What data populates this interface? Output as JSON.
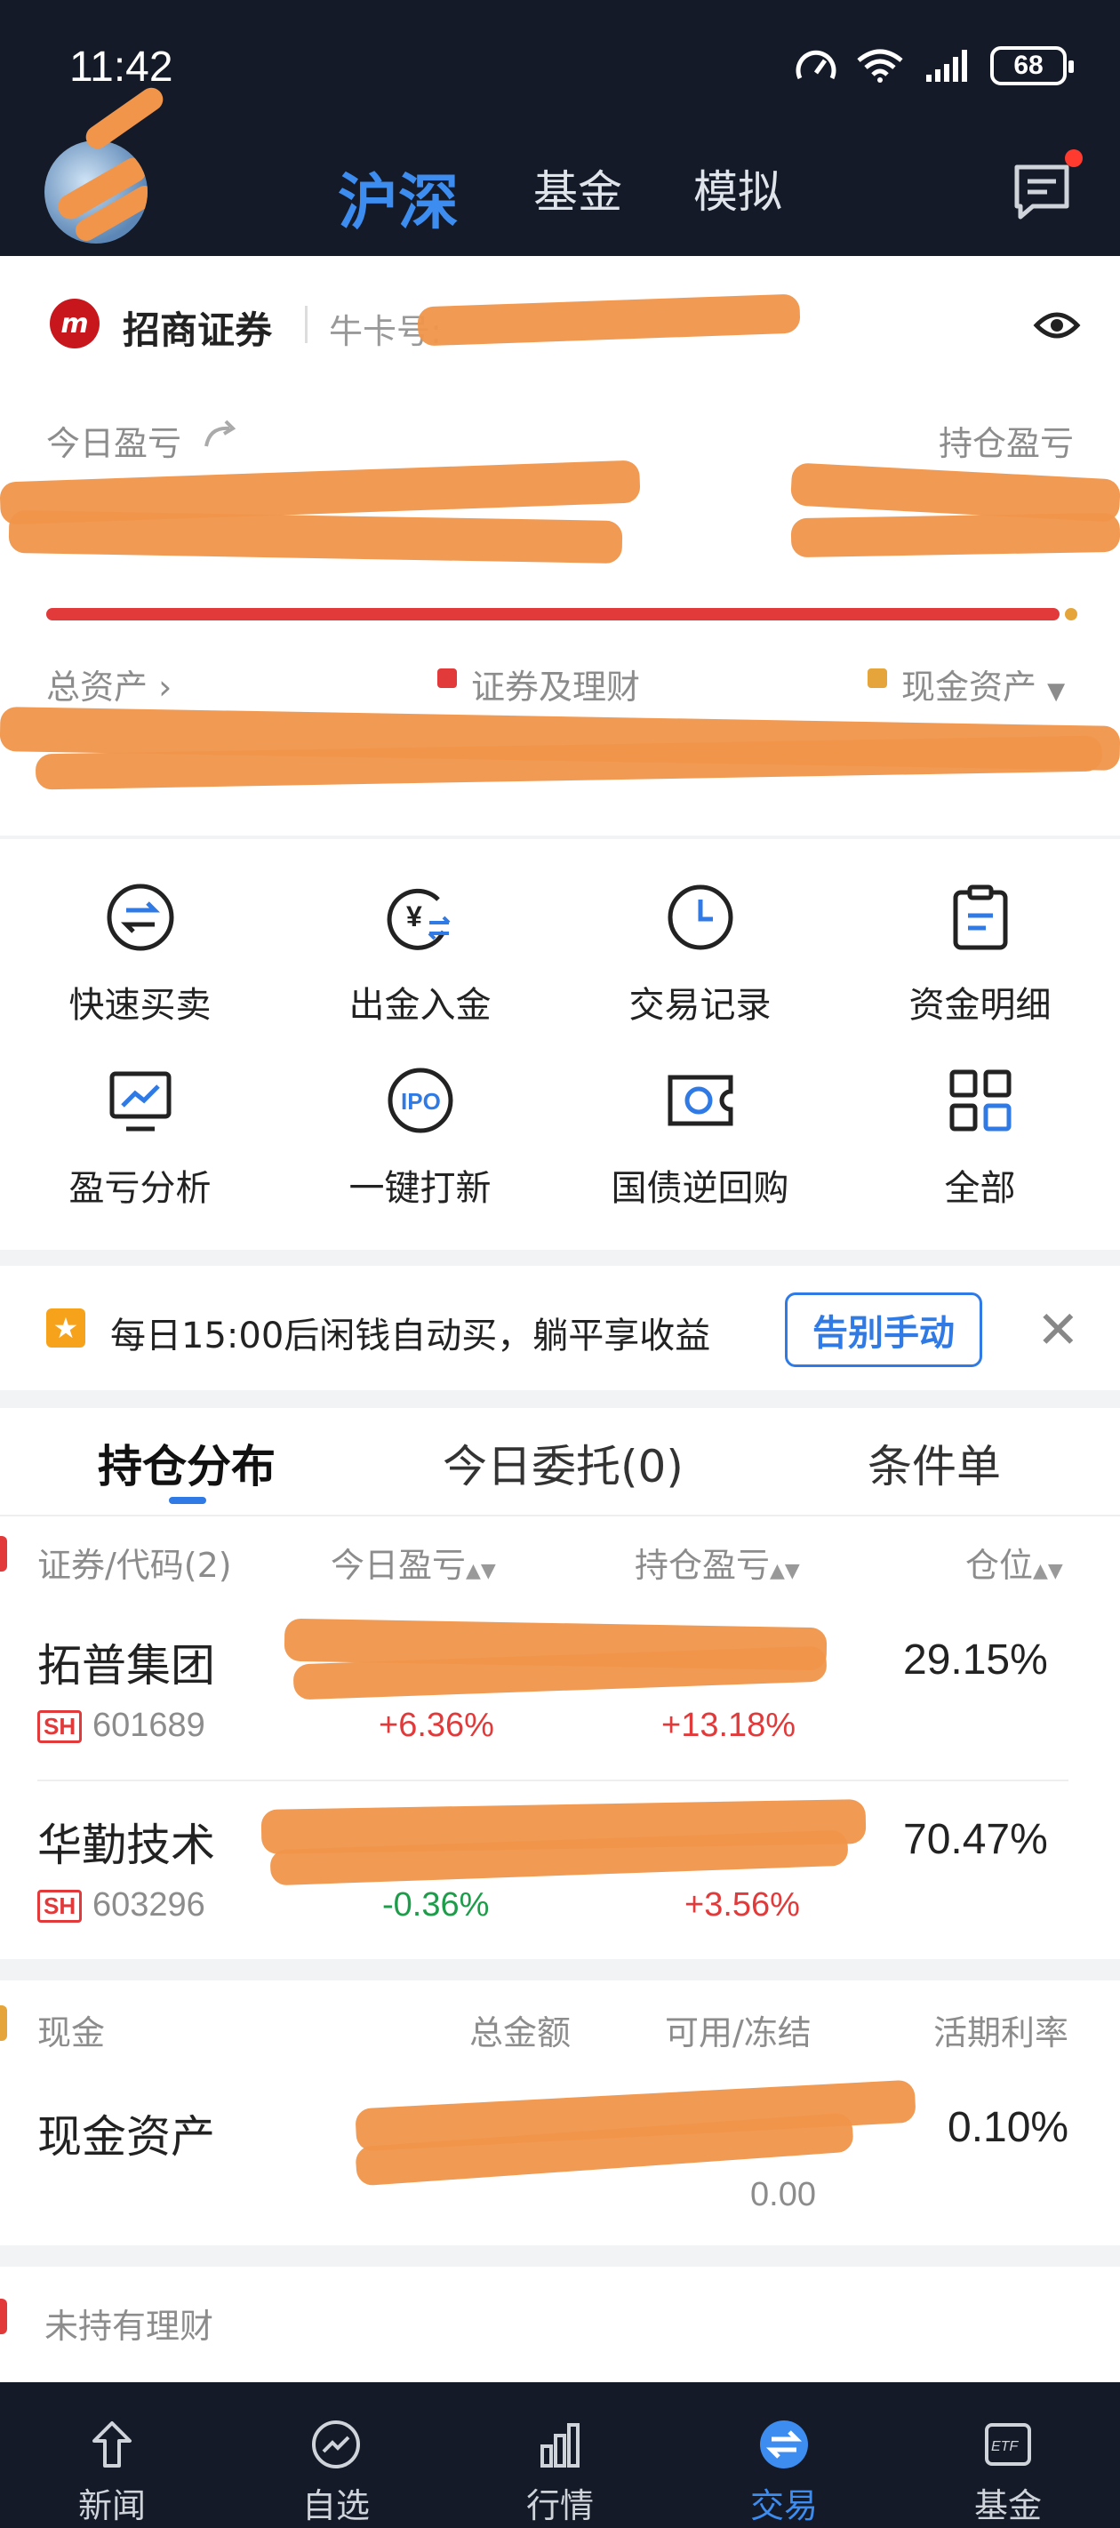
{
  "status_bar": {
    "time": "11:42",
    "battery": "68"
  },
  "header": {
    "tabs": [
      {
        "label": "沪深",
        "active": true
      },
      {
        "label": "基金",
        "active": false
      },
      {
        "label": "模拟",
        "active": false
      }
    ],
    "icons": [
      "avatar",
      "message-icon"
    ]
  },
  "account": {
    "broker_name": "招商证券",
    "account_label": "牛卡号:",
    "today_pnl_label": "今日盈亏",
    "holding_pnl_label": "持仓盈亏",
    "total_assets_label": "总资产",
    "securities_label": "证券及理财",
    "cash_assets_label": "现金资产",
    "legend_colors": {
      "securities": "#e23a3a",
      "cash": "#e6a53a"
    }
  },
  "quick_actions": [
    {
      "label": "快速买卖",
      "icon": "exchange-icon"
    },
    {
      "label": "出金入金",
      "icon": "yuan-transfer-icon"
    },
    {
      "label": "交易记录",
      "icon": "clock-icon"
    },
    {
      "label": "资金明细",
      "icon": "clipboard-icon"
    },
    {
      "label": "盈亏分析",
      "icon": "chart-monitor-icon"
    },
    {
      "label": "一键打新",
      "icon": "ipo-icon"
    },
    {
      "label": "国债逆回购",
      "icon": "ticket-icon"
    },
    {
      "label": "全部",
      "icon": "grid-icon"
    }
  ],
  "banner": {
    "text": "每日15:00后闲钱自动买，躺平享收益",
    "button": "告别手动"
  },
  "positions": {
    "tabs": [
      "持仓分布",
      "今日委托(0)",
      "条件单"
    ],
    "columns": [
      "证券/代码(2)",
      "今日盈亏",
      "持仓盈亏",
      "仓位"
    ],
    "rows": [
      {
        "name": "拓普集团",
        "market": "SH",
        "code": "601689",
        "today_pct": "+6.36%",
        "holding_pct": "+13.18%",
        "weight": "29.15%"
      },
      {
        "name": "华勤技术",
        "market": "SH",
        "code": "603296",
        "today_pct": "-0.36%",
        "holding_pct": "+3.56%",
        "weight": "70.47%"
      }
    ]
  },
  "cash": {
    "section_label": "现金",
    "columns": [
      "总金额",
      "可用/冻结",
      "活期利率"
    ],
    "name": "现金资产",
    "frozen": "0.00",
    "rate": "0.10%"
  },
  "unheld": {
    "label": "未持有理财"
  },
  "bottom_nav": [
    {
      "label": "新闻",
      "active": false
    },
    {
      "label": "自选",
      "active": false
    },
    {
      "label": "行情",
      "active": false
    },
    {
      "label": "交易",
      "active": true
    },
    {
      "label": "基金",
      "active": false
    }
  ]
}
